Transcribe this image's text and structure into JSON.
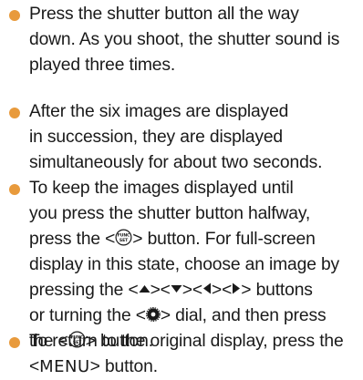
{
  "colors": {
    "bullet": "#e89a3c",
    "text": "#1a1a1a",
    "icon": "#1a1a1a"
  },
  "items": [
    {
      "lines": [
        "Press the shutter button all the way",
        "down. As you shoot, the shutter sound is",
        "played three times."
      ]
    },
    {
      "lines": [
        "After the six images are displayed",
        "in succession, they are displayed",
        "simultaneously for about two seconds."
      ]
    },
    {
      "line1": "To keep the images displayed until",
      "line2": "you press the shutter button halfway,",
      "line3_pre": "press the <",
      "line3_post": "> button. For full-screen",
      "line4": "display in this state, choose an image by",
      "line5_pre": "pressing the <",
      "line5_sep": "><",
      "line5_post": "> buttons",
      "line6_pre": "or turning the <",
      "line6_post": "> dial, and then press",
      "line7_pre": "the <",
      "line7_post": "> button.",
      "func_icon_label_top": "FUNC",
      "func_icon_label_bottom": "SET"
    },
    {
      "line1": "To return to the original display, press the",
      "line2_pre": "<",
      "line2_menu": "MENU",
      "line2_post": "> button."
    }
  ]
}
